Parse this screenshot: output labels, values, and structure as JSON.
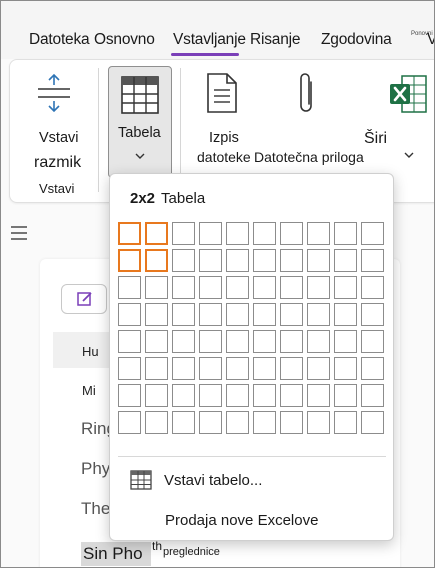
{
  "tabs": [
    {
      "label": "Datoteka"
    },
    {
      "label": "Osnovno"
    },
    {
      "label": "Vstavljanje"
    },
    {
      "label": "Risanje"
    },
    {
      "label": "Zgodovina"
    },
    {
      "label": "Ponovni"
    },
    {
      "label": "V"
    }
  ],
  "ribbon": {
    "space_label_1": "Vstavi",
    "space_label_2": "razmik",
    "group_label": "Vstavi",
    "table_label": "Tabela",
    "printout_label_1": "Izpis",
    "printout_label_2": "datoteke",
    "attachment_label": "Datotečna priloga",
    "spreadsheet_label": "Širi"
  },
  "dropdown": {
    "size_label": "2x2",
    "title": "Tabela",
    "selected": {
      "rows": 2,
      "cols": 2
    },
    "grid": {
      "rows": 8,
      "cols": 10
    },
    "insert_table_label": "Vstavi tabelo...",
    "new_excel_label": "Prodaja nove Excelove",
    "new_excel_suffix": "preglednice"
  },
  "document": {
    "row_hu": "Hu",
    "row_mi": "Mi",
    "line_ring": "Ring",
    "line_phy": "Phy",
    "line_the": "The",
    "line_sin": "Sin Pho",
    "line_sin_sup": "th"
  },
  "colors": {
    "accent_underline": "#7a3fb8",
    "selection": "#e8781e",
    "excel_green": "#1e7145"
  }
}
